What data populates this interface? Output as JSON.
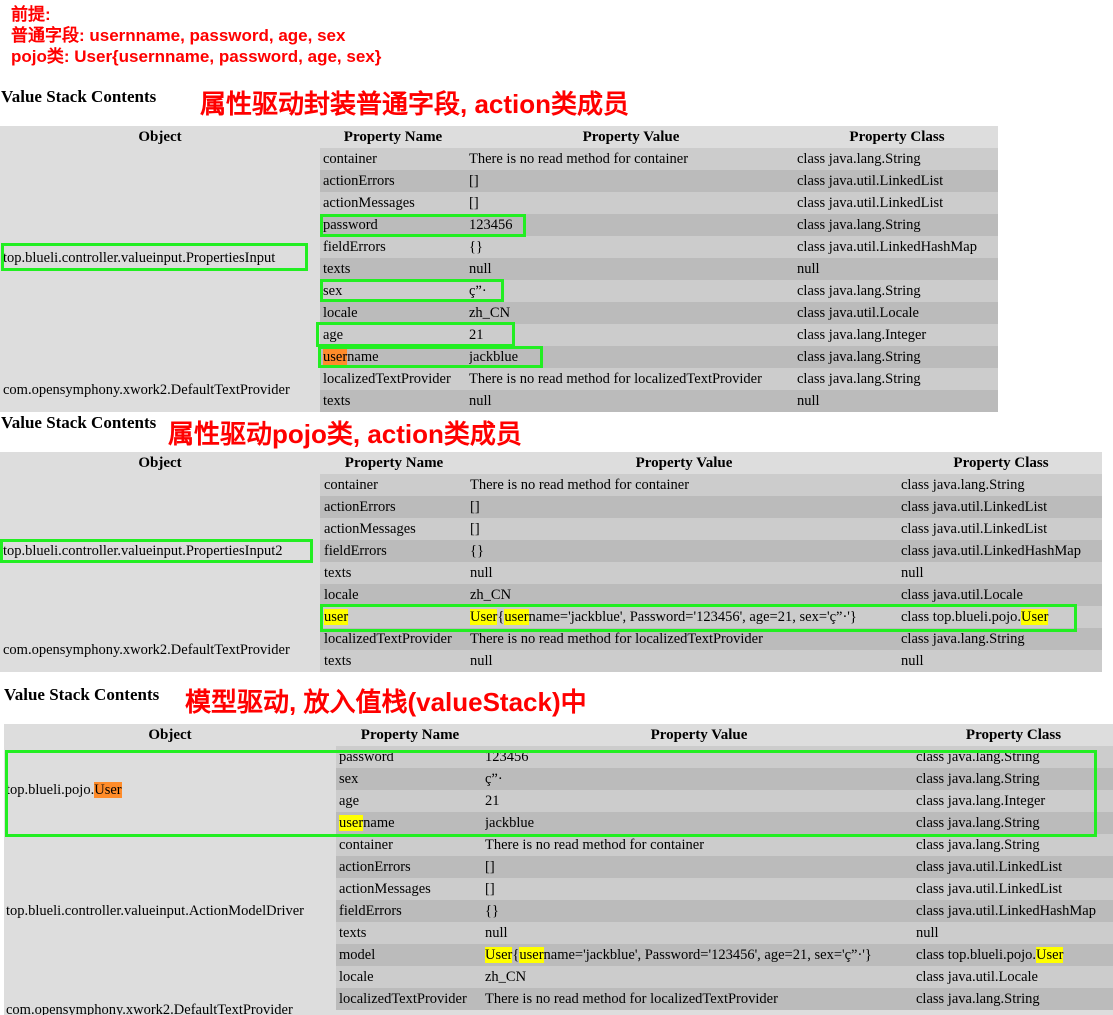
{
  "premise": {
    "line1": "前提:",
    "line2": "普通字段: usernname, password, age, sex",
    "line3": "pojo类: User{usernname, password, age, sex}"
  },
  "colors": {
    "annotation": "#ff0000",
    "box": "#22ee22",
    "highlight_orange": "#ff8c2a",
    "highlight_yellow": "#ffff00",
    "row_dark": "#bbbbbb",
    "row_light": "#cccccc",
    "table_bg": "#dddddd"
  },
  "headers": {
    "object": "Object",
    "name": "Property Name",
    "value": "Property Value",
    "class": "Property Class"
  },
  "section1": {
    "title": "Value Stack Contents",
    "note": "属性驱动封装普通字段, action类成员",
    "obj1": "top.blueli.controller.valueinput.PropertiesInput",
    "obj2": "com.opensymphony.xwork2.DefaultTextProvider",
    "rows": [
      [
        "container",
        "There is no read method for container",
        "class java.lang.String"
      ],
      [
        "actionErrors",
        "[]",
        "class java.util.LinkedList"
      ],
      [
        "actionMessages",
        "[]",
        "class java.util.LinkedList"
      ],
      [
        "password",
        "123456",
        "class java.lang.String"
      ],
      [
        "fieldErrors",
        "{}",
        "class java.util.LinkedHashMap"
      ],
      [
        "texts",
        "null",
        "null"
      ],
      [
        "sex",
        "ç”·",
        "class java.lang.String"
      ],
      [
        "locale",
        "zh_CN",
        "class java.util.Locale"
      ],
      [
        "age",
        "21",
        "class java.lang.Integer"
      ],
      [
        "username",
        "jackblue",
        "class java.lang.String"
      ],
      [
        "localizedTextProvider",
        "There is no read method for localizedTextProvider",
        "class java.lang.String"
      ],
      [
        "texts",
        "null",
        "null"
      ]
    ],
    "username_hl": "user",
    "username_rest": "name"
  },
  "section2": {
    "title": "Value Stack Contents",
    "note": "属性驱动pojo类, action类成员",
    "obj1": "top.blueli.controller.valueinput.PropertiesInput2",
    "obj2": "com.opensymphony.xwork2.DefaultTextProvider",
    "rows": [
      [
        "container",
        "There is no read method for container",
        "class java.lang.String"
      ],
      [
        "actionErrors",
        "[]",
        "class java.util.LinkedList"
      ],
      [
        "actionMessages",
        "[]",
        "class java.util.LinkedList"
      ],
      [
        "fieldErrors",
        "{}",
        "class java.util.LinkedHashMap"
      ],
      [
        "texts",
        "null",
        "null"
      ],
      [
        "locale",
        "zh_CN",
        "class java.util.Locale"
      ],
      [
        "user",
        "",
        ""
      ],
      [
        "localizedTextProvider",
        "There is no read method for localizedTextProvider",
        "class java.lang.String"
      ],
      [
        "texts",
        "null",
        "null"
      ]
    ],
    "user_value": {
      "a": "User",
      "b": "{",
      "c": "user",
      "d": "name='jackblue', Password='123456', age=21, sex='ç”·'}"
    },
    "user_class": {
      "a": "class top.blueli.pojo.",
      "b": "User"
    }
  },
  "section3": {
    "title": "Value Stack Contents",
    "note": "模型驱动, 放入值栈(valueStack)中",
    "obj1_prefix": "top.blueli.pojo.",
    "obj1_hl": "User",
    "obj2": "top.blueli.controller.valueinput.ActionModelDriver",
    "obj3": "com.opensymphony.xwork2.DefaultTextProvider",
    "rows": [
      [
        "password",
        "123456",
        "class java.lang.String"
      ],
      [
        "sex",
        "ç”·",
        "class java.lang.String"
      ],
      [
        "age",
        "21",
        "class java.lang.Integer"
      ],
      [
        "username",
        "jackblue",
        "class java.lang.String"
      ],
      [
        "container",
        "There is no read method for container",
        "class java.lang.String"
      ],
      [
        "actionErrors",
        "[]",
        "class java.util.LinkedList"
      ],
      [
        "actionMessages",
        "[]",
        "class java.util.LinkedList"
      ],
      [
        "fieldErrors",
        "{}",
        "class java.util.LinkedHashMap"
      ],
      [
        "texts",
        "null",
        "null"
      ],
      [
        "model",
        "",
        ""
      ],
      [
        "locale",
        "zh_CN",
        "class java.util.Locale"
      ],
      [
        "localizedTextProvider",
        "There is no read method for localizedTextProvider",
        "class java.lang.String"
      ]
    ],
    "model_value": {
      "a": "User",
      "b": "{",
      "c": "user",
      "d": "name='jackblue', Password='123456', age=21, sex='ç”·'}"
    },
    "model_class": {
      "a": "class top.blueli.pojo.",
      "b": "User"
    }
  }
}
